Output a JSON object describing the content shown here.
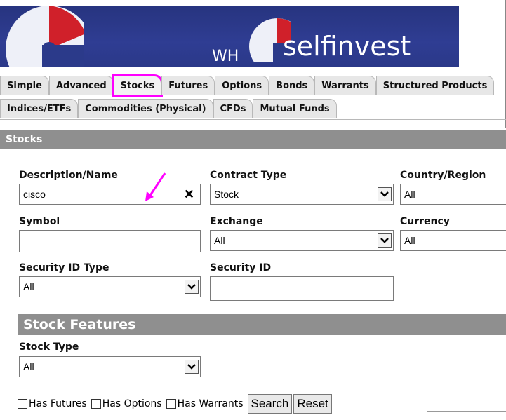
{
  "brand": {
    "wh": "WH",
    "name": "selfinvest"
  },
  "tabs_row1": [
    "Simple",
    "Advanced",
    "Stocks",
    "Futures",
    "Options",
    "Bonds",
    "Warrants",
    "Structured Products"
  ],
  "tabs_row2": [
    "Indices/ETFs",
    "Commodities (Physical)",
    "CFDs",
    "Mutual Funds"
  ],
  "active_tab": "Stocks",
  "section_title": "Stocks",
  "form": {
    "description_label": "Description/Name",
    "description_value": "cisco",
    "contract_type_label": "Contract Type",
    "contract_type_value": "Stock",
    "country_label": "Country/Region",
    "country_value": "All",
    "symbol_label": "Symbol",
    "symbol_value": "",
    "exchange_label": "Exchange",
    "exchange_value": "All",
    "currency_label": "Currency",
    "currency_value": "All",
    "security_id_type_label": "Security ID Type",
    "security_id_type_value": "All",
    "security_id_label": "Security ID",
    "security_id_value": ""
  },
  "features": {
    "title": "Stock Features",
    "stock_type_label": "Stock Type",
    "stock_type_value": "All",
    "has_futures": "Has Futures",
    "has_options": "Has Options",
    "has_warrants": "Has Warrants"
  },
  "buttons": {
    "search": "Search",
    "reset": "Reset"
  },
  "colors": {
    "banner": "#2b3a8a",
    "highlight": "#ff00ff",
    "section_bar": "#8f8f8f"
  }
}
